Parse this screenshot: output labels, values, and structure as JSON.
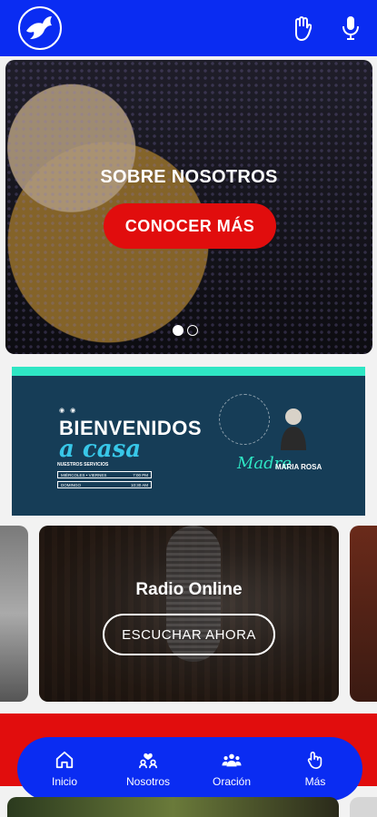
{
  "header": {
    "logo_icon": "dove-logo-icon",
    "prayer_icon": "raised-hand-icon",
    "voice_icon": "microphone-icon",
    "brand_color": "#0a2cf2"
  },
  "hero": {
    "title": "SOBRE NOSOTROS",
    "button_label": "CONOCER MÁS",
    "button_color": "#e10d0d",
    "slides_total": 2,
    "active_slide": 1
  },
  "banner": {
    "title_line1": "BIENVENIDOS",
    "title_line2": "a casa",
    "schedule_heading": "NUESTROS SERVICIOS",
    "rows": [
      {
        "day": "MIÉRCOLES • VIERNES",
        "time": "7:00 PM"
      },
      {
        "day": "DOMINGO",
        "time": "10:30 AM"
      }
    ],
    "signature": "Madre",
    "name": "MARIA ROSA"
  },
  "radio": {
    "title": "Radio Online",
    "button_label": "ESCUCHAR AHORA"
  },
  "bottom_nav": {
    "items": [
      {
        "label": "Inicio",
        "icon": "home-icon"
      },
      {
        "label": "Nosotros",
        "icon": "people-heart-icon"
      },
      {
        "label": "Oración",
        "icon": "group-icon"
      },
      {
        "label": "Más",
        "icon": "hand-gesture-icon"
      }
    ]
  }
}
